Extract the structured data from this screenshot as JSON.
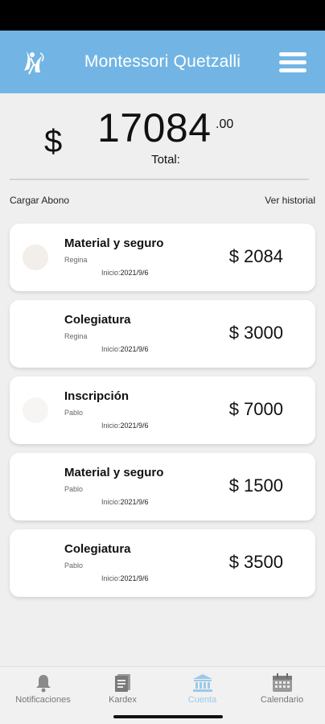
{
  "header": {
    "title": "Montessori Quetzalli"
  },
  "balance": {
    "currency": "$",
    "amount_integer": "17084",
    "amount_decimals": ".00",
    "label": "Total:"
  },
  "actions": {
    "load_payment": "Cargar Abono",
    "view_history": "Ver historial"
  },
  "payments": [
    {
      "concept": "Material y seguro",
      "student": "Regina",
      "start_label": "Inicio:",
      "start_date": "2021/9/6",
      "amount": "$ 2084"
    },
    {
      "concept": "Colegiatura",
      "student": "Regina",
      "start_label": "Inicio:",
      "start_date": "2021/9/6",
      "amount": "$ 3000"
    },
    {
      "concept": "Inscripción",
      "student": "Pablo",
      "start_label": "Inicio:",
      "start_date": "2021/9/6",
      "amount": "$ 7000"
    },
    {
      "concept": "Material y seguro",
      "student": "Pablo",
      "start_label": "Inicio:",
      "start_date": "2021/9/6",
      "amount": "$ 1500"
    },
    {
      "concept": "Colegiatura",
      "student": "Pablo",
      "start_label": "Inicio:",
      "start_date": "2021/9/6",
      "amount": "$ 3500"
    }
  ],
  "tabs": [
    {
      "label": "Notificaciones",
      "icon": "bell-icon",
      "active": false
    },
    {
      "label": "Kardex",
      "icon": "document-icon",
      "active": false
    },
    {
      "label": "Cuenta",
      "icon": "bank-icon",
      "active": true
    },
    {
      "label": "Calendario",
      "icon": "calendar-icon",
      "active": false
    }
  ],
  "colors": {
    "header": "#72b5e4",
    "active_tab": "#9cc9ea",
    "inactive_tab": "#8a8a8a"
  }
}
